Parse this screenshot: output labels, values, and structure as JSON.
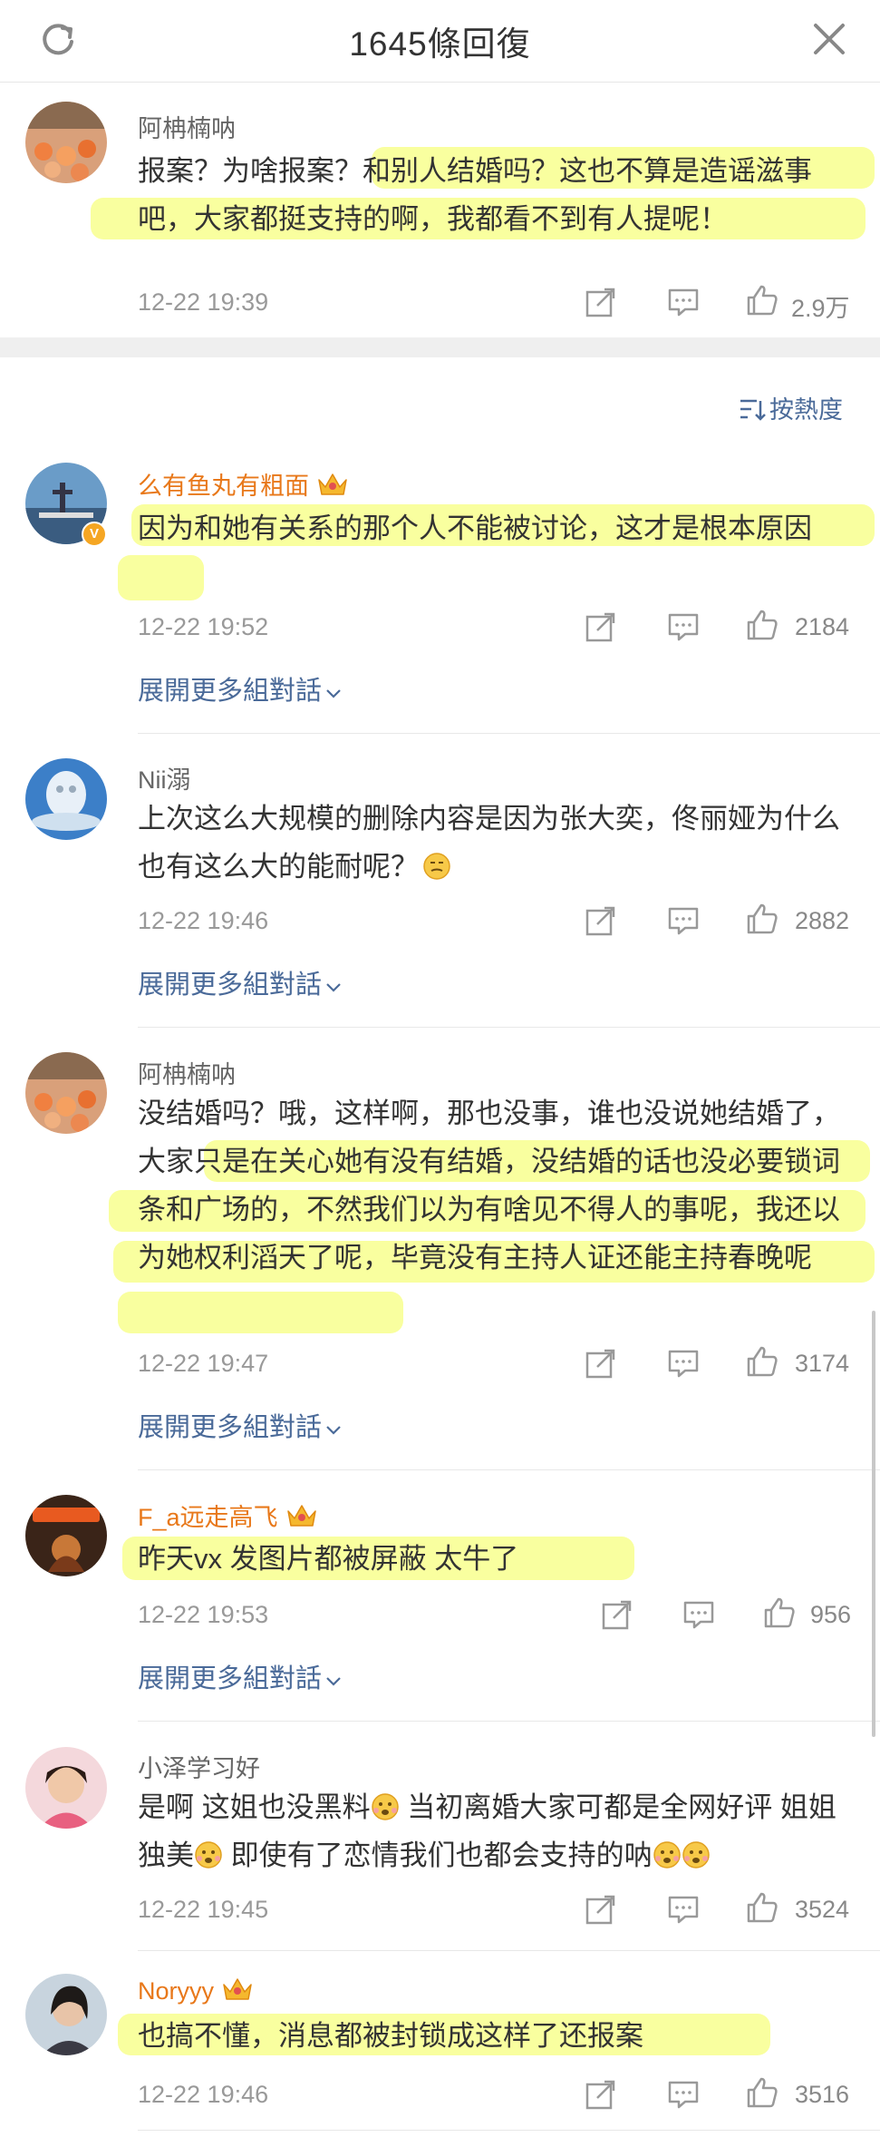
{
  "header": {
    "title": "1645條回復"
  },
  "sort": {
    "label": "按熱度"
  },
  "expand_label": "展開更多組對話",
  "top_comment": {
    "user": "阿柟楠呐",
    "text": "报案？为啥报案？和别人结婚吗？这也不算是造谣滋事吧，大家都挺支持的啊，我都看不到有人提呢！",
    "time": "12-22 19:39",
    "likes": "2.9万"
  },
  "comments": [
    {
      "user": "么有鱼丸有粗面",
      "text": "因为和她有关系的那个人不能被讨论，这才是根本原因",
      "time": "12-22 19:52",
      "likes": "2184"
    },
    {
      "user": "Nii溺",
      "text": "上次这么大规模的删除内容是因为张大奕，佟丽娅为什么也有这么大的能耐呢？",
      "time": "12-22 19:46",
      "likes": "2882"
    },
    {
      "user": "阿柟楠呐",
      "text": "没结婚吗？哦，这样啊，那也没事，谁也没说她结婚了，大家只是在关心她有没有结婚，没结婚的话也没必要锁词条和广场的，不然我们以为有啥见不得人的事呢，我还以为她权利滔天了呢，毕竟没有主持人证还能主持春晚呢",
      "time": "12-22 19:47",
      "likes": "3174"
    },
    {
      "user": "F_a远走高飞",
      "text": "昨天vx 发图片都被屏蔽 太牛了",
      "time": "12-22 19:53",
      "likes": "956"
    },
    {
      "user": "小泽学习好",
      "text_a": "是啊 这姐也没黑料",
      "text_b": " 当初离婚大家可都是全网好评 姐姐独美",
      "text_c": " 即使有了恋情我们也都会支持的呐",
      "time": "12-22 19:45",
      "likes": "3524"
    },
    {
      "user": "Noryyy",
      "text": "也搞不懂，消息都被封锁成这样了还报案",
      "time": "12-22 19:46",
      "likes": "3516"
    }
  ],
  "colors": {
    "vip_name": "#e8781a",
    "link": "#4a6a99",
    "highlight": "#f4ff50"
  },
  "icons": [
    "refresh-icon",
    "close-icon",
    "share-icon",
    "comment-icon",
    "like-icon",
    "sort-icon",
    "crown-icon",
    "verified-icon",
    "emoji-icon"
  ]
}
